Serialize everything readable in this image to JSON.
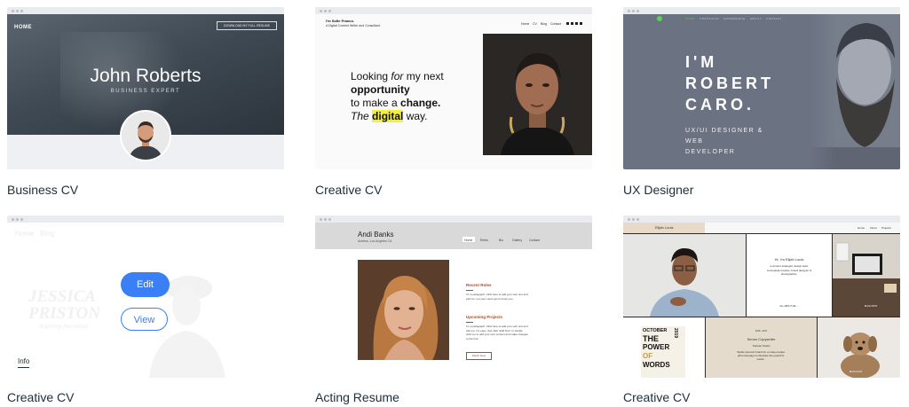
{
  "cards": [
    {
      "title": "Business CV",
      "preview": {
        "nav": "HOME",
        "download_button": "DOWNLOAD MY FULL RESUME",
        "name": "John Roberts",
        "role": "BUSINESS EXPERT"
      }
    },
    {
      "title": "Creative CV",
      "preview": {
        "brand": "I'm Sofie Franco.",
        "brand_sub": "A Digital Content Writer and Consultant.",
        "nav": [
          "Home",
          "CV",
          "Blog",
          "Contact"
        ],
        "social_icons": [
          "facebook-icon",
          "twitter-icon",
          "linkedin-icon",
          "instagram-icon"
        ],
        "tagline": {
          "looking": "Looking",
          "for": "for",
          "my_next": "my next",
          "opportunity": "opportunity",
          "to_make_a": "to make a",
          "change": "change.",
          "the": "The",
          "digital": "digital",
          "way": "way."
        }
      }
    },
    {
      "title": "UX Designer",
      "preview": {
        "nav": [
          "HOME",
          "PORTFOLIO",
          "EXPERIENCE",
          "ABOUT",
          "CONTACT"
        ],
        "title_lines": [
          "I'M",
          "ROBERT",
          "CARO."
        ],
        "subtitle_lines": [
          "UX/UI DESIGNER & WEB",
          "DEVELOPER"
        ],
        "accent": "#57d44e"
      }
    },
    {
      "title": "Creative CV",
      "preview": {
        "nav": [
          "Home",
          "Blog"
        ],
        "name_lines": [
          "JESSICA",
          "PRISTON"
        ],
        "subtitle": "Aspiring journalist"
      },
      "hover": {
        "edit_label": "Edit",
        "view_label": "View",
        "info_label": "Info",
        "accent": "#3a7ff6"
      }
    },
    {
      "title": "Acting Resume",
      "preview": {
        "name": "Andi Banks",
        "location": "Actress, Los Angeles CA",
        "nav": [
          "Home",
          "Reels",
          "Bio",
          "Gallery",
          "Contact"
        ],
        "section1_title": "Recent Roles",
        "section1_text": "I'm a paragraph. Click here to add your own text and edit me. Let your users get to know you.",
        "section2_title": "Upcoming Projects",
        "section2_text": "I'm a paragraph. Click here to add your own text and edit me. It's easy. Just click \"Edit Text\" or double click me to add your own content and make changes to the font.",
        "button": "Watch Reel",
        "accent": "#a64b2a"
      }
    },
    {
      "title": "Creative CV",
      "preview": {
        "name": "Elijah Louis",
        "nav": [
          "Home",
          "About",
          "Projects"
        ],
        "intro_title": "Hi, I'm Elijah Louis",
        "intro_text": "a content strategist, design lead, conceptual creative, brand designer & photographer.",
        "about_link": "ALL ABOUT ME →",
        "poster_lines": [
          "OCTOBER",
          "THE",
          "POWER",
          "OF",
          "WORDS"
        ],
        "poster_year": "2019",
        "job_years": "2018 - 2017",
        "job_title": "Senior Copywriter",
        "job_company": "Telestar Studio",
        "job_text": "Tactile slow-ish brand for a mass-market print campaign to illustrate the power of words.",
        "blog_label": "BLOG POST",
        "blog_label2": "BLOG POST"
      }
    }
  ]
}
